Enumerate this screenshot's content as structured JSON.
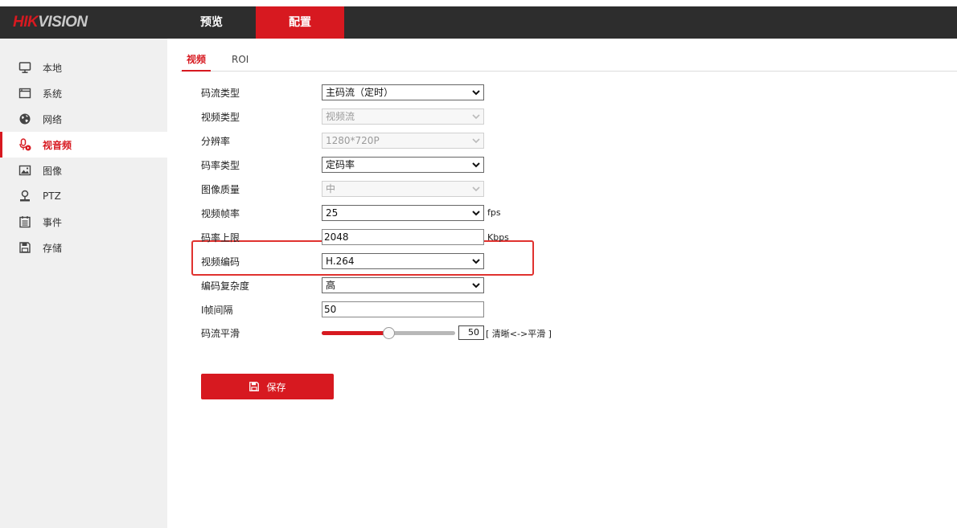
{
  "brand": {
    "logo_red": "HIK",
    "logo_grey": "VISION"
  },
  "colors": {
    "accent": "#d71920",
    "header_bg": "#2d2d2d",
    "sidebar_bg": "#f0f0f0",
    "highlight": "#e0322f"
  },
  "nav": {
    "items": [
      {
        "label": "预览"
      },
      {
        "label": "配置",
        "active": true
      }
    ]
  },
  "sidebar": {
    "items": [
      {
        "label": "本地",
        "icon": "monitor-icon"
      },
      {
        "label": "系统",
        "icon": "window-icon"
      },
      {
        "label": "网络",
        "icon": "globe-icon"
      },
      {
        "label": "视音频",
        "icon": "mic-icon",
        "active": true
      },
      {
        "label": "图像",
        "icon": "image-icon"
      },
      {
        "label": "PTZ",
        "icon": "ptz-camera-icon"
      },
      {
        "label": "事件",
        "icon": "calendar-icon"
      },
      {
        "label": "存储",
        "icon": "floppy-icon"
      }
    ]
  },
  "tabs": [
    {
      "label": "视频",
      "active": true
    },
    {
      "label": "ROI"
    }
  ],
  "form": {
    "stream_type": {
      "label": "码流类型",
      "value": "主码流（定时）"
    },
    "video_type": {
      "label": "视频类型",
      "value": "视频流",
      "disabled": true
    },
    "resolution": {
      "label": "分辨率",
      "value": "1280*720P",
      "disabled": true
    },
    "bitrate_type": {
      "label": "码率类型",
      "value": "定码率"
    },
    "image_quality": {
      "label": "图像质量",
      "value": "中",
      "disabled": true
    },
    "frame_rate": {
      "label": "视频帧率",
      "value": "25",
      "unit": "fps"
    },
    "bitrate_limit": {
      "label": "码率上限",
      "value": "2048",
      "unit": "Kbps"
    },
    "video_encoding": {
      "label": "视频编码",
      "value": "H.264"
    },
    "encoding_complexity": {
      "label": "编码复杂度",
      "value": "高"
    },
    "i_frame_interval": {
      "label": "I帧间隔",
      "value": "50"
    },
    "stream_smoothing": {
      "label": "码流平滑",
      "value": "50",
      "level_percent": 50,
      "note": "[ 清晰<->平滑 ]"
    }
  },
  "save_label": "保存"
}
